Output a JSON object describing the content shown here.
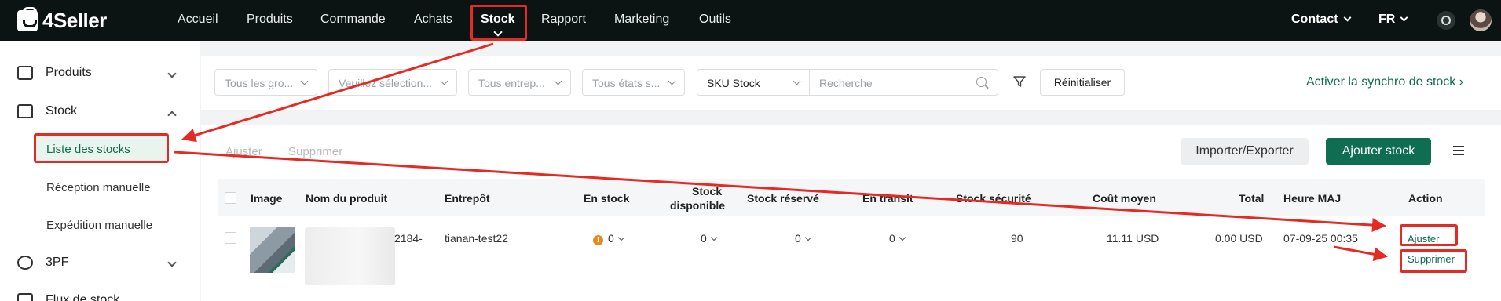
{
  "brand": {
    "name": "4Seller"
  },
  "nav": {
    "items": [
      "Accueil",
      "Produits",
      "Commande",
      "Achats",
      "Stock",
      "Rapport",
      "Marketing",
      "Outils"
    ],
    "active": "Stock",
    "contact": "Contact",
    "language": "FR"
  },
  "sidebar": {
    "groups": [
      {
        "label": "Produits",
        "expanded": false
      },
      {
        "label": "Stock",
        "expanded": true
      },
      {
        "label": "3PF",
        "expanded": false
      },
      {
        "label": "Flux de stock",
        "expanded": false
      }
    ],
    "stock_items": [
      "Liste des stocks",
      "Réception manuelle",
      "Expédition manuelle"
    ],
    "active_item": "Liste des stocks"
  },
  "filters": {
    "group": "Tous les gro...",
    "select": "Veuillez sélection...",
    "warehouse": "Tous entrep...",
    "state": "Tous états s...",
    "sku_type": "SKU Stock",
    "search_placeholder": "Recherche",
    "reset": "Réinitialiser",
    "sync_link": "Activer la synchro de stock"
  },
  "toolbar": {
    "adjust": "Ajuster",
    "delete": "Supprimer",
    "import_export": "Importer/Exporter",
    "add_stock": "Ajouter stock"
  },
  "table": {
    "headers": {
      "image": "Image",
      "product": "Nom du produit",
      "warehouse": "Entrepôt",
      "in_stock": "En stock",
      "available_1": "Stock",
      "available_2": "disponible",
      "reserved": "Stock réservé",
      "transit": "En transit",
      "safety": "Stock sécurité",
      "avg_cost": "Coût moyen",
      "total": "Total",
      "updated": "Heure MAJ",
      "action": "Action"
    },
    "row": {
      "product_suffix": "2184-",
      "warehouse": "tianan-test22",
      "in_stock": "0",
      "available": "0",
      "reserved": "0",
      "transit": "0",
      "safety": "90",
      "avg_cost": "11.11",
      "avg_cost_currency": "USD",
      "total": "0.00",
      "total_currency": "USD",
      "updated": "07-09-25 00:35",
      "actions": [
        "Ajuster",
        "Supprimer"
      ]
    }
  },
  "colors": {
    "topbar": "#0b1412",
    "accent": "#0f6e52",
    "link": "#0a6b4e",
    "annotation": "#e52a23"
  }
}
